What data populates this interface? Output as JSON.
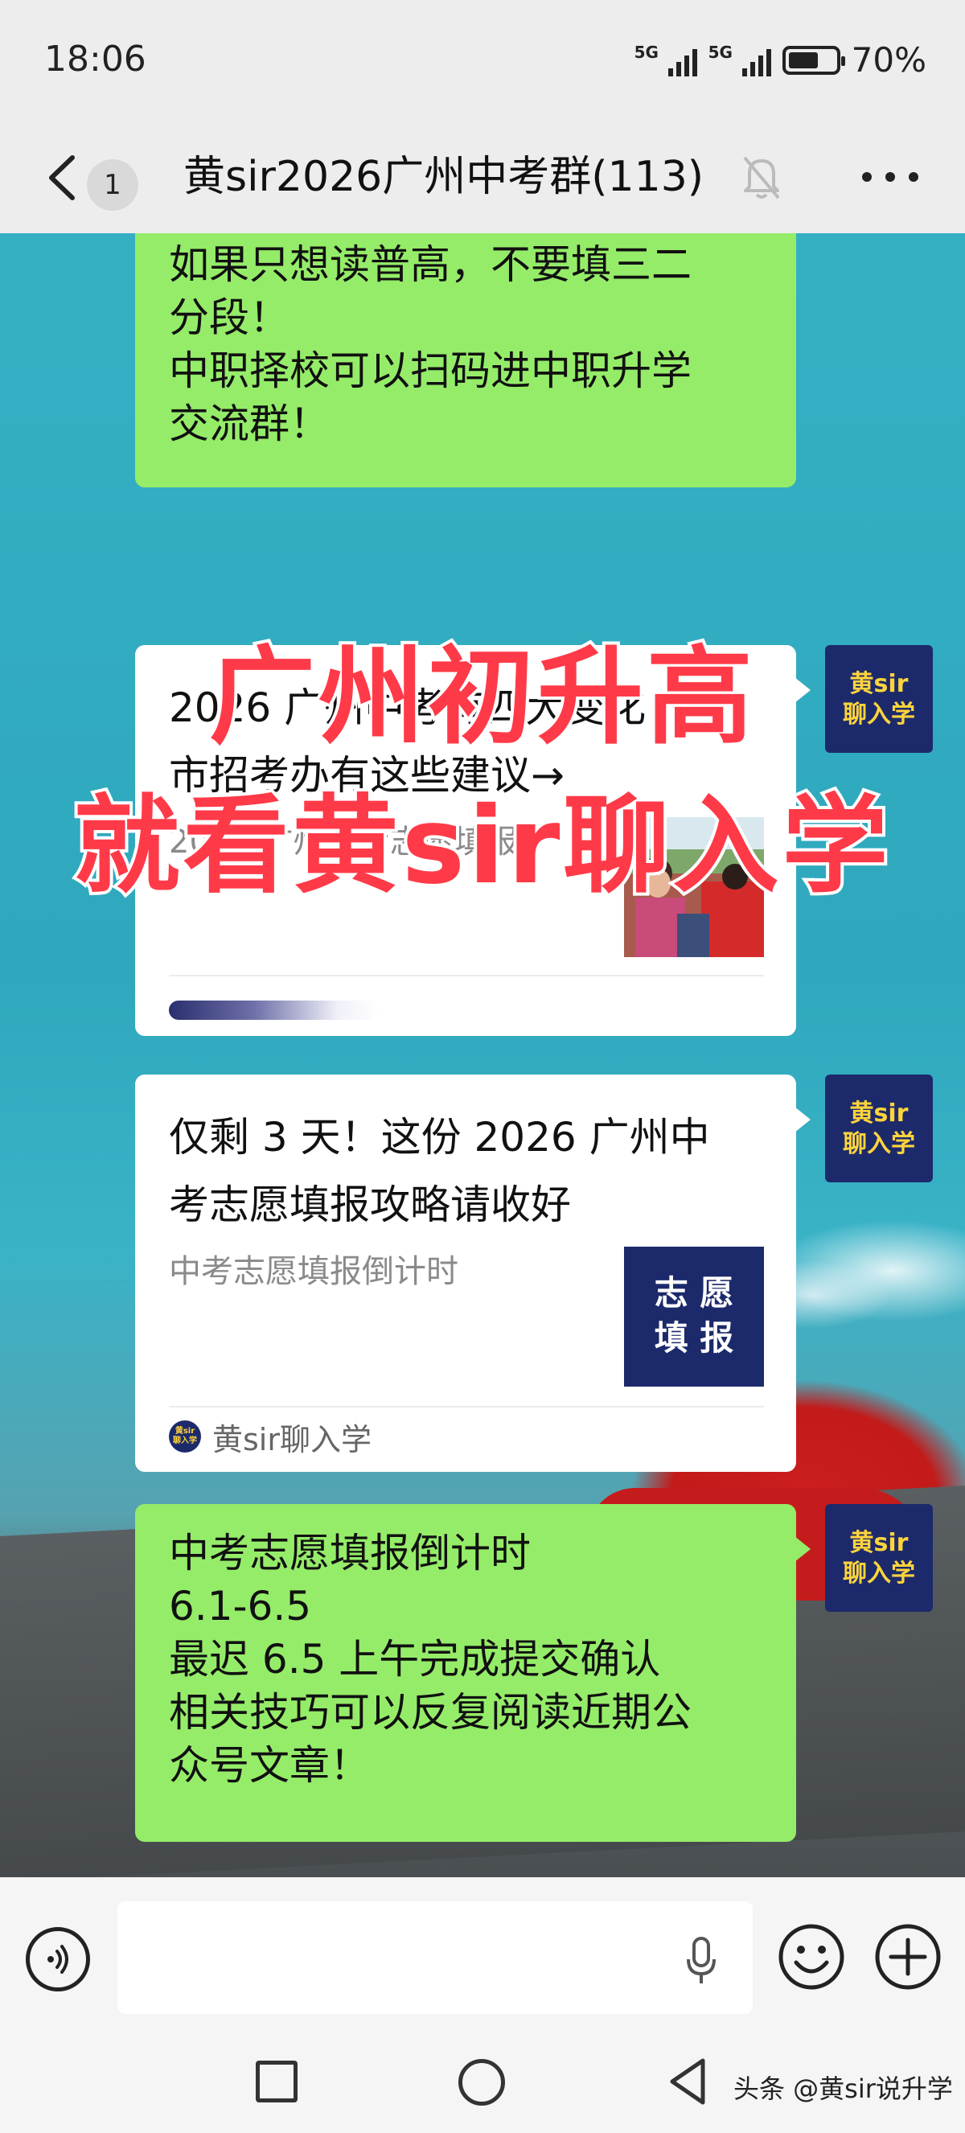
{
  "status_bar": {
    "time": "18:06",
    "network_1": "5G",
    "network_2": "5G",
    "battery": "70%"
  },
  "header": {
    "unread_count": "1",
    "title": "黄sir2026广州中考群(113)",
    "icons": [
      "back-arrow-icon",
      "mute-bell-icon",
      "more-dots-icon"
    ]
  },
  "promo_overlay": {
    "line1": "广州初升高",
    "line2": "就看黄sir聊入学"
  },
  "messages": [
    {
      "type": "text",
      "lines": [
        "如果只想读普高，不要填三二",
        "分段！",
        "中职择校可以扫码进中职升学",
        "交流群！"
      ]
    },
    {
      "type": "article",
      "avatar_lines": [
        "黄sir",
        "聊入学"
      ],
      "title_lines": [
        "2026 广州中考有四大变化！",
        "市招考办有这些建议→"
      ],
      "description": "2026 广州中考志愿填报"
    },
    {
      "type": "article",
      "avatar_lines": [
        "黄sir",
        "聊入学"
      ],
      "title_lines": [
        "仅剩 3 天！这份 2026 广州中",
        "考志愿填报攻略请收好"
      ],
      "description": "中考志愿填报倒计时",
      "thumb_text": [
        "志 愿",
        "填 报"
      ],
      "source_logo": [
        "黄sir",
        "聊入学"
      ],
      "source": "黄sir聊入学"
    },
    {
      "type": "text",
      "avatar_lines": [
        "黄sir",
        "聊入学"
      ],
      "lines": [
        "中考志愿填报倒计时",
        "6.1-6.5",
        "最迟 6.5 上午完成提交确认",
        "相关技巧可以反复阅读近期公",
        "众号文章！"
      ]
    }
  ],
  "input_bar": {
    "placeholder": "",
    "icons": [
      "voice-icon",
      "mic-icon",
      "emoji-icon",
      "plus-icon"
    ]
  },
  "nav_bar": {
    "icons": [
      "recent-apps-icon",
      "home-icon",
      "back-icon"
    ],
    "watermark": "头条 @黄sir说升学"
  },
  "colors": {
    "bubble_green": "#95ec69",
    "avatar_bg": "#1c2a6b",
    "avatar_text": "#ffd43b",
    "promo_red": "#ff3a48"
  }
}
